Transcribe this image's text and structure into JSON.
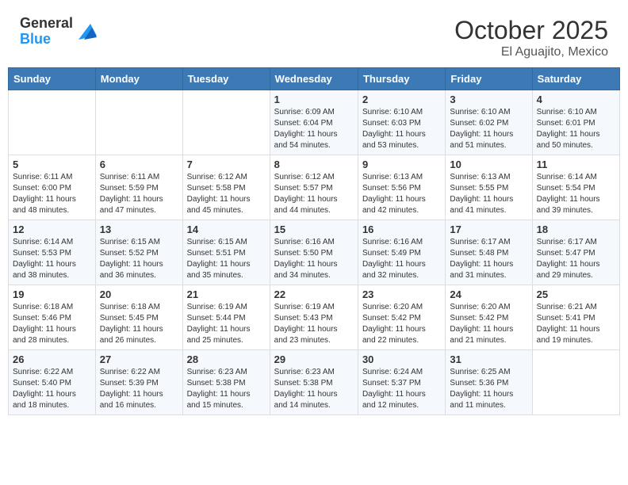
{
  "header": {
    "logo_general": "General",
    "logo_blue": "Blue",
    "month": "October 2025",
    "location": "El Aguajito, Mexico"
  },
  "weekdays": [
    "Sunday",
    "Monday",
    "Tuesday",
    "Wednesday",
    "Thursday",
    "Friday",
    "Saturday"
  ],
  "weeks": [
    [
      {
        "day": "",
        "info": ""
      },
      {
        "day": "",
        "info": ""
      },
      {
        "day": "",
        "info": ""
      },
      {
        "day": "1",
        "info": "Sunrise: 6:09 AM\nSunset: 6:04 PM\nDaylight: 11 hours\nand 54 minutes."
      },
      {
        "day": "2",
        "info": "Sunrise: 6:10 AM\nSunset: 6:03 PM\nDaylight: 11 hours\nand 53 minutes."
      },
      {
        "day": "3",
        "info": "Sunrise: 6:10 AM\nSunset: 6:02 PM\nDaylight: 11 hours\nand 51 minutes."
      },
      {
        "day": "4",
        "info": "Sunrise: 6:10 AM\nSunset: 6:01 PM\nDaylight: 11 hours\nand 50 minutes."
      }
    ],
    [
      {
        "day": "5",
        "info": "Sunrise: 6:11 AM\nSunset: 6:00 PM\nDaylight: 11 hours\nand 48 minutes."
      },
      {
        "day": "6",
        "info": "Sunrise: 6:11 AM\nSunset: 5:59 PM\nDaylight: 11 hours\nand 47 minutes."
      },
      {
        "day": "7",
        "info": "Sunrise: 6:12 AM\nSunset: 5:58 PM\nDaylight: 11 hours\nand 45 minutes."
      },
      {
        "day": "8",
        "info": "Sunrise: 6:12 AM\nSunset: 5:57 PM\nDaylight: 11 hours\nand 44 minutes."
      },
      {
        "day": "9",
        "info": "Sunrise: 6:13 AM\nSunset: 5:56 PM\nDaylight: 11 hours\nand 42 minutes."
      },
      {
        "day": "10",
        "info": "Sunrise: 6:13 AM\nSunset: 5:55 PM\nDaylight: 11 hours\nand 41 minutes."
      },
      {
        "day": "11",
        "info": "Sunrise: 6:14 AM\nSunset: 5:54 PM\nDaylight: 11 hours\nand 39 minutes."
      }
    ],
    [
      {
        "day": "12",
        "info": "Sunrise: 6:14 AM\nSunset: 5:53 PM\nDaylight: 11 hours\nand 38 minutes."
      },
      {
        "day": "13",
        "info": "Sunrise: 6:15 AM\nSunset: 5:52 PM\nDaylight: 11 hours\nand 36 minutes."
      },
      {
        "day": "14",
        "info": "Sunrise: 6:15 AM\nSunset: 5:51 PM\nDaylight: 11 hours\nand 35 minutes."
      },
      {
        "day": "15",
        "info": "Sunrise: 6:16 AM\nSunset: 5:50 PM\nDaylight: 11 hours\nand 34 minutes."
      },
      {
        "day": "16",
        "info": "Sunrise: 6:16 AM\nSunset: 5:49 PM\nDaylight: 11 hours\nand 32 minutes."
      },
      {
        "day": "17",
        "info": "Sunrise: 6:17 AM\nSunset: 5:48 PM\nDaylight: 11 hours\nand 31 minutes."
      },
      {
        "day": "18",
        "info": "Sunrise: 6:17 AM\nSunset: 5:47 PM\nDaylight: 11 hours\nand 29 minutes."
      }
    ],
    [
      {
        "day": "19",
        "info": "Sunrise: 6:18 AM\nSunset: 5:46 PM\nDaylight: 11 hours\nand 28 minutes."
      },
      {
        "day": "20",
        "info": "Sunrise: 6:18 AM\nSunset: 5:45 PM\nDaylight: 11 hours\nand 26 minutes."
      },
      {
        "day": "21",
        "info": "Sunrise: 6:19 AM\nSunset: 5:44 PM\nDaylight: 11 hours\nand 25 minutes."
      },
      {
        "day": "22",
        "info": "Sunrise: 6:19 AM\nSunset: 5:43 PM\nDaylight: 11 hours\nand 23 minutes."
      },
      {
        "day": "23",
        "info": "Sunrise: 6:20 AM\nSunset: 5:42 PM\nDaylight: 11 hours\nand 22 minutes."
      },
      {
        "day": "24",
        "info": "Sunrise: 6:20 AM\nSunset: 5:42 PM\nDaylight: 11 hours\nand 21 minutes."
      },
      {
        "day": "25",
        "info": "Sunrise: 6:21 AM\nSunset: 5:41 PM\nDaylight: 11 hours\nand 19 minutes."
      }
    ],
    [
      {
        "day": "26",
        "info": "Sunrise: 6:22 AM\nSunset: 5:40 PM\nDaylight: 11 hours\nand 18 minutes."
      },
      {
        "day": "27",
        "info": "Sunrise: 6:22 AM\nSunset: 5:39 PM\nDaylight: 11 hours\nand 16 minutes."
      },
      {
        "day": "28",
        "info": "Sunrise: 6:23 AM\nSunset: 5:38 PM\nDaylight: 11 hours\nand 15 minutes."
      },
      {
        "day": "29",
        "info": "Sunrise: 6:23 AM\nSunset: 5:38 PM\nDaylight: 11 hours\nand 14 minutes."
      },
      {
        "day": "30",
        "info": "Sunrise: 6:24 AM\nSunset: 5:37 PM\nDaylight: 11 hours\nand 12 minutes."
      },
      {
        "day": "31",
        "info": "Sunrise: 6:25 AM\nSunset: 5:36 PM\nDaylight: 11 hours\nand 11 minutes."
      },
      {
        "day": "",
        "info": ""
      }
    ]
  ]
}
